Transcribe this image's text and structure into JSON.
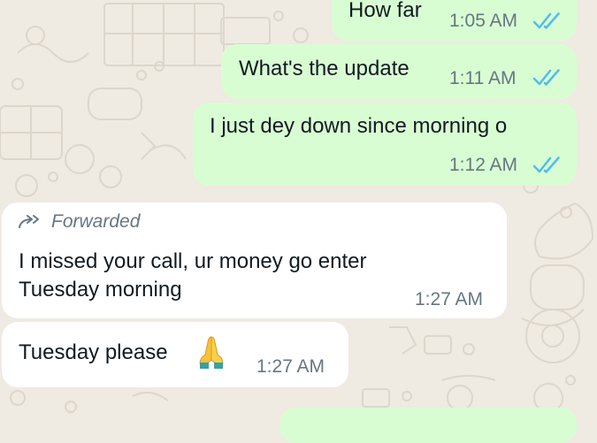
{
  "messages": [
    {
      "direction": "outgoing",
      "text": "How far",
      "time": "1:05 AM",
      "status": "read",
      "status_icon": "double-check-icon"
    },
    {
      "direction": "outgoing",
      "text": "What's the update",
      "time": "1:11 AM",
      "status": "read",
      "status_icon": "double-check-icon"
    },
    {
      "direction": "outgoing",
      "text": "I just dey down since morning o",
      "time": "1:12 AM",
      "status": "read",
      "status_icon": "double-check-icon"
    },
    {
      "direction": "incoming",
      "forwarded_label": "Forwarded",
      "forwarded_icon": "forward-arrows-icon",
      "lines": [
        "I missed your call, ur money go enter",
        "Tuesday morning"
      ],
      "time": "1:27 AM"
    },
    {
      "direction": "incoming",
      "text": "Tuesday please",
      "emoji": "folded-hands-icon",
      "time": "1:27 AM"
    }
  ],
  "colors": {
    "background": "#efeae2",
    "outgoing_bubble": "#d9fdd3",
    "incoming_bubble": "#ffffff",
    "read_ticks": "#53bdeb",
    "meta_text": "#667781"
  }
}
